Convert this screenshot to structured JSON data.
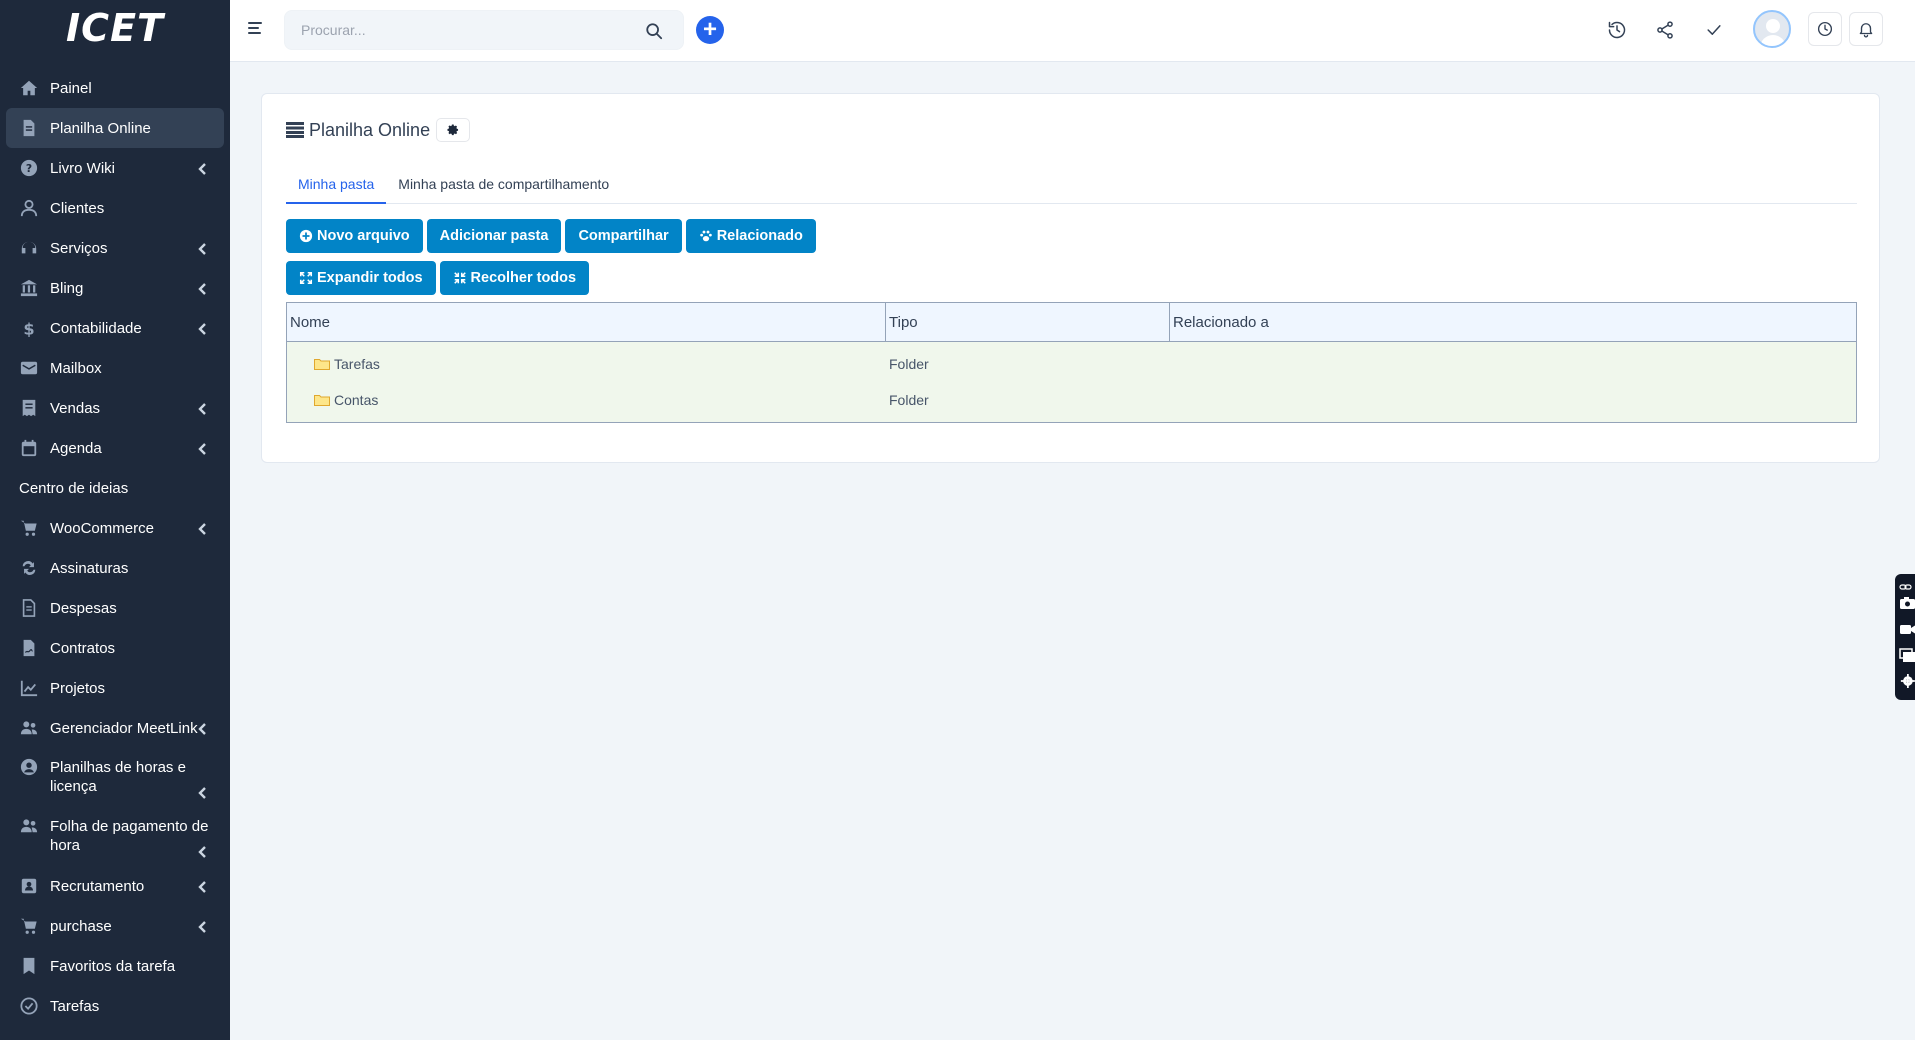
{
  "app": {
    "logo_text": "ICET"
  },
  "search": {
    "placeholder": "Procurar..."
  },
  "sidebar": {
    "items": [
      {
        "label": "Painel",
        "icon": "home-icon",
        "chevron": false
      },
      {
        "label": "Planilha Online",
        "icon": "file-icon",
        "chevron": false,
        "active": true
      },
      {
        "label": "Livro Wiki",
        "icon": "question-icon",
        "chevron": true
      },
      {
        "label": "Clientes",
        "icon": "user-icon",
        "chevron": false
      },
      {
        "label": "Serviços",
        "icon": "headset-icon",
        "chevron": true
      },
      {
        "label": "Bling",
        "icon": "bank-icon",
        "chevron": true
      },
      {
        "label": "Contabilidade",
        "icon": "dollar-icon",
        "chevron": true
      },
      {
        "label": "Mailbox",
        "icon": "envelope-icon",
        "chevron": false
      },
      {
        "label": "Vendas",
        "icon": "receipt-icon",
        "chevron": true
      },
      {
        "label": "Agenda",
        "icon": "calendar-icon",
        "chevron": true
      },
      {
        "label": "Centro de ideias",
        "icon": "",
        "chevron": false
      },
      {
        "label": "WooCommerce",
        "icon": "cart-icon",
        "chevron": true
      },
      {
        "label": "Assinaturas",
        "icon": "repeat-icon",
        "chevron": false
      },
      {
        "label": "Despesas",
        "icon": "document-icon",
        "chevron": false
      },
      {
        "label": "Contratos",
        "icon": "contract-icon",
        "chevron": false
      },
      {
        "label": "Projetos",
        "icon": "chart-icon",
        "chevron": false
      },
      {
        "label": "Gerenciador MeetLink",
        "icon": "users-icon",
        "chevron": true
      },
      {
        "label": "Planilhas de horas e licença",
        "icon": "user-circle-icon",
        "chevron": true
      },
      {
        "label": "Folha de pagamento de hora",
        "icon": "users-icon",
        "chevron": true
      },
      {
        "label": "Recrutamento",
        "icon": "id-card-icon",
        "chevron": true
      },
      {
        "label": "purchase",
        "icon": "cart-icon",
        "chevron": true
      },
      {
        "label": "Favoritos da tarefa",
        "icon": "bookmark-icon",
        "chevron": false
      },
      {
        "label": "Tarefas",
        "icon": "check-circle-icon",
        "chevron": false
      }
    ]
  },
  "page": {
    "title": "Planilha Online",
    "tabs": [
      {
        "label": "Minha pasta",
        "active": true
      },
      {
        "label": "Minha pasta de compartilhamento",
        "active": false
      }
    ],
    "buttons_row1": [
      {
        "label": "Novo arquivo",
        "icon": "plus-circle-icon"
      },
      {
        "label": "Adicionar pasta",
        "icon": ""
      },
      {
        "label": "Compartilhar",
        "icon": ""
      },
      {
        "label": "Relacionado",
        "icon": "paw-icon"
      }
    ],
    "buttons_row2": [
      {
        "label": "Expandir todos",
        "icon": "expand-icon"
      },
      {
        "label": "Recolher todos",
        "icon": "collapse-icon"
      }
    ],
    "table": {
      "columns": [
        "Nome",
        "Tipo",
        "Relacionado a"
      ],
      "rows": [
        {
          "name": "Tarefas",
          "type": "Folder",
          "related": ""
        },
        {
          "name": "Contas",
          "type": "Folder",
          "related": ""
        }
      ]
    }
  },
  "colors": {
    "sidebar_bg": "#1e293b",
    "accent": "#2563eb",
    "button": "#0284c7",
    "row_bg": "#f0f7ec"
  }
}
